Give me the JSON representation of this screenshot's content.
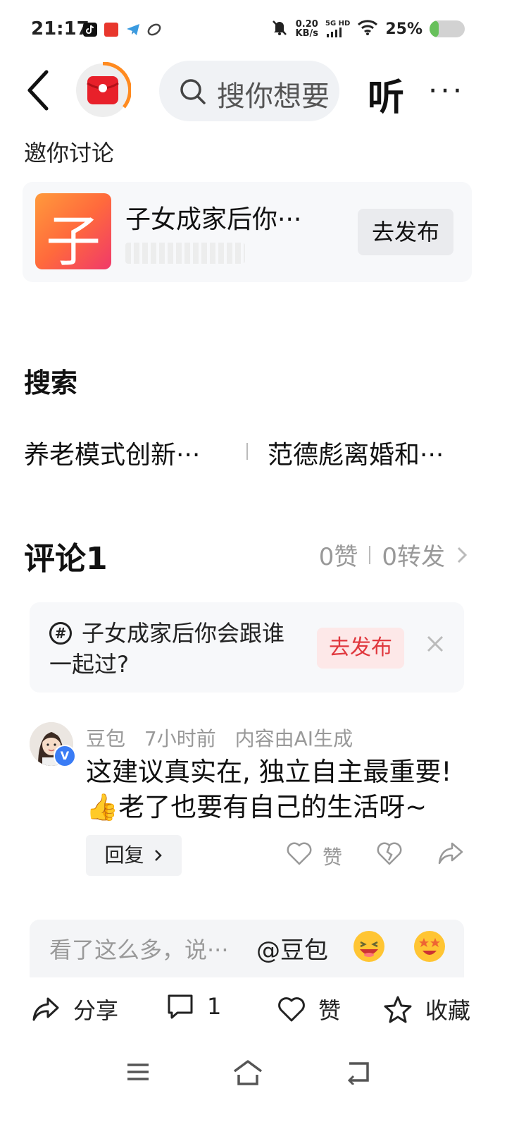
{
  "status_bar": {
    "time": "21:17",
    "net_speed_value": "0.20",
    "net_speed_unit": "KB/s",
    "signal_label": "5G HD",
    "battery_percent": "25%",
    "battery_level": 0.25,
    "icons": [
      "tiktok-icon",
      "toutiao-icon",
      "telegram-icon",
      "link-icon",
      "mute-icon",
      "signal-icon",
      "wifi-icon"
    ]
  },
  "header": {
    "search_placeholder": "搜你想要",
    "listen_label": "听",
    "more_label": "···"
  },
  "invite": {
    "title": "邀你讨论",
    "thumb_char": "子",
    "topic": "子女成家后你···",
    "publish_label": "去发布"
  },
  "search": {
    "title": "搜索",
    "suggestions": [
      "养老模式创新···",
      "范德彪离婚和···"
    ]
  },
  "comments": {
    "title": "评论1",
    "likes": "0赞",
    "reposts": "0转发",
    "banner": {
      "topic": "子女成家后你会跟谁一起过?",
      "publish_label": "去发布"
    },
    "items": [
      {
        "author": "豆包",
        "time": "7小时前",
        "note": "内容由AI生成",
        "badge": "V",
        "text": "这建议真实在, 独立自主最重要! 👍老了也要有自己的生活呀~",
        "reply_label": "回复",
        "like_label": "赞"
      }
    ],
    "input": {
      "placeholder": "看了这么多，说···",
      "mention": "@豆包"
    }
  },
  "bottom_bar": {
    "share_label": "分享",
    "comment_count": "1",
    "like_label": "赞",
    "favorite_label": "收藏"
  },
  "colors": {
    "accent_red": "#e0383e",
    "badge_blue": "#3a7cf5",
    "battery_green": "#67c05b"
  }
}
